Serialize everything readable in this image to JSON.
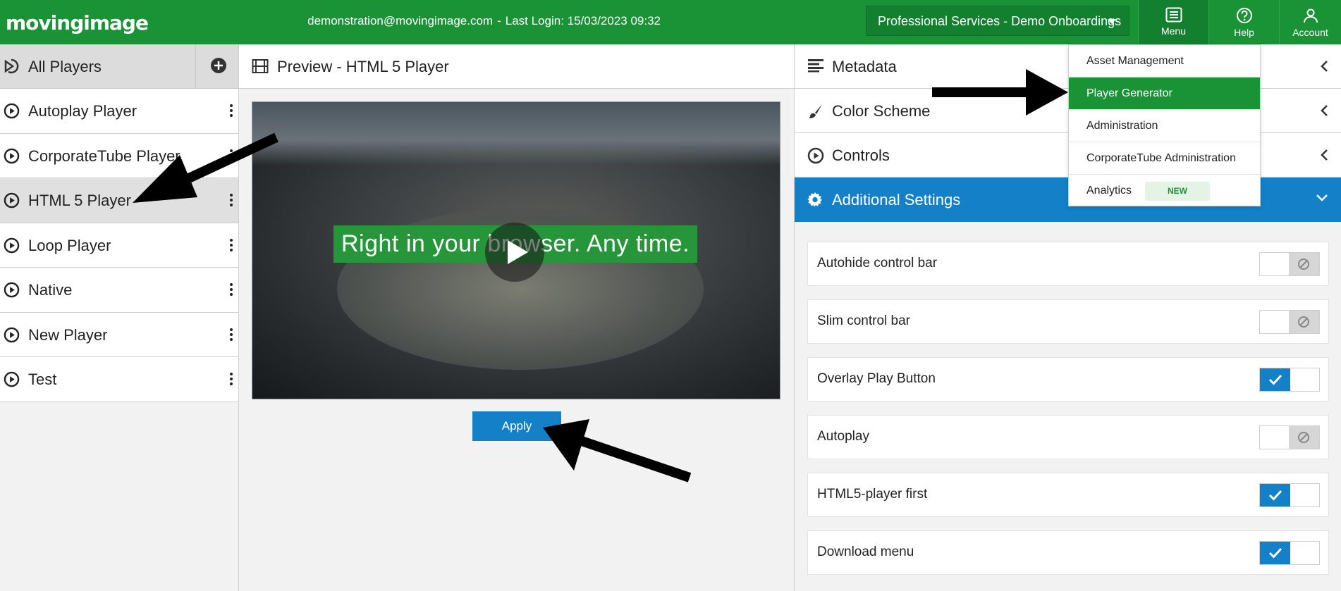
{
  "topbar": {
    "logo": "movingimage",
    "user_email": "demonstration@movingimage.com",
    "separator": "-",
    "last_login": "Last Login: 15/03/2023 09:32",
    "org_select": "Professional Services - Demo Onboardings",
    "menu_label": "Menu",
    "help_label": "Help",
    "account_label": "Account"
  },
  "sidebar": {
    "header": "All Players",
    "items": [
      {
        "label": "Autoplay Player"
      },
      {
        "label": "CorporateTube Player"
      },
      {
        "label": "HTML 5 Player"
      },
      {
        "label": "Loop Player"
      },
      {
        "label": "Native"
      },
      {
        "label": "New Player"
      },
      {
        "label": "Test"
      }
    ]
  },
  "center": {
    "title": "Preview - HTML 5 Player",
    "video_caption": "Right in your browser. Any time.",
    "apply_label": "Apply"
  },
  "right": {
    "sections": [
      {
        "title": "Metadata"
      },
      {
        "title": "Color Scheme"
      },
      {
        "title": "Controls"
      },
      {
        "title": "Additional Settings"
      }
    ],
    "settings": [
      {
        "label": "Autohide control bar",
        "enabled": false
      },
      {
        "label": "Slim control bar",
        "enabled": false
      },
      {
        "label": "Overlay Play Button",
        "enabled": true
      },
      {
        "label": "Autoplay",
        "enabled": false
      },
      {
        "label": "HTML5-player first",
        "enabled": true
      },
      {
        "label": "Download menu",
        "enabled": true
      }
    ]
  },
  "dropdown": {
    "items": [
      {
        "label": "Asset Management"
      },
      {
        "label": "Player Generator"
      },
      {
        "label": "Administration"
      },
      {
        "label": "CorporateTube Administration"
      },
      {
        "label": "Analytics"
      }
    ],
    "new_badge": "NEW"
  },
  "colors": {
    "brand_green": "#1a9236",
    "accent_blue": "#1380c8"
  }
}
